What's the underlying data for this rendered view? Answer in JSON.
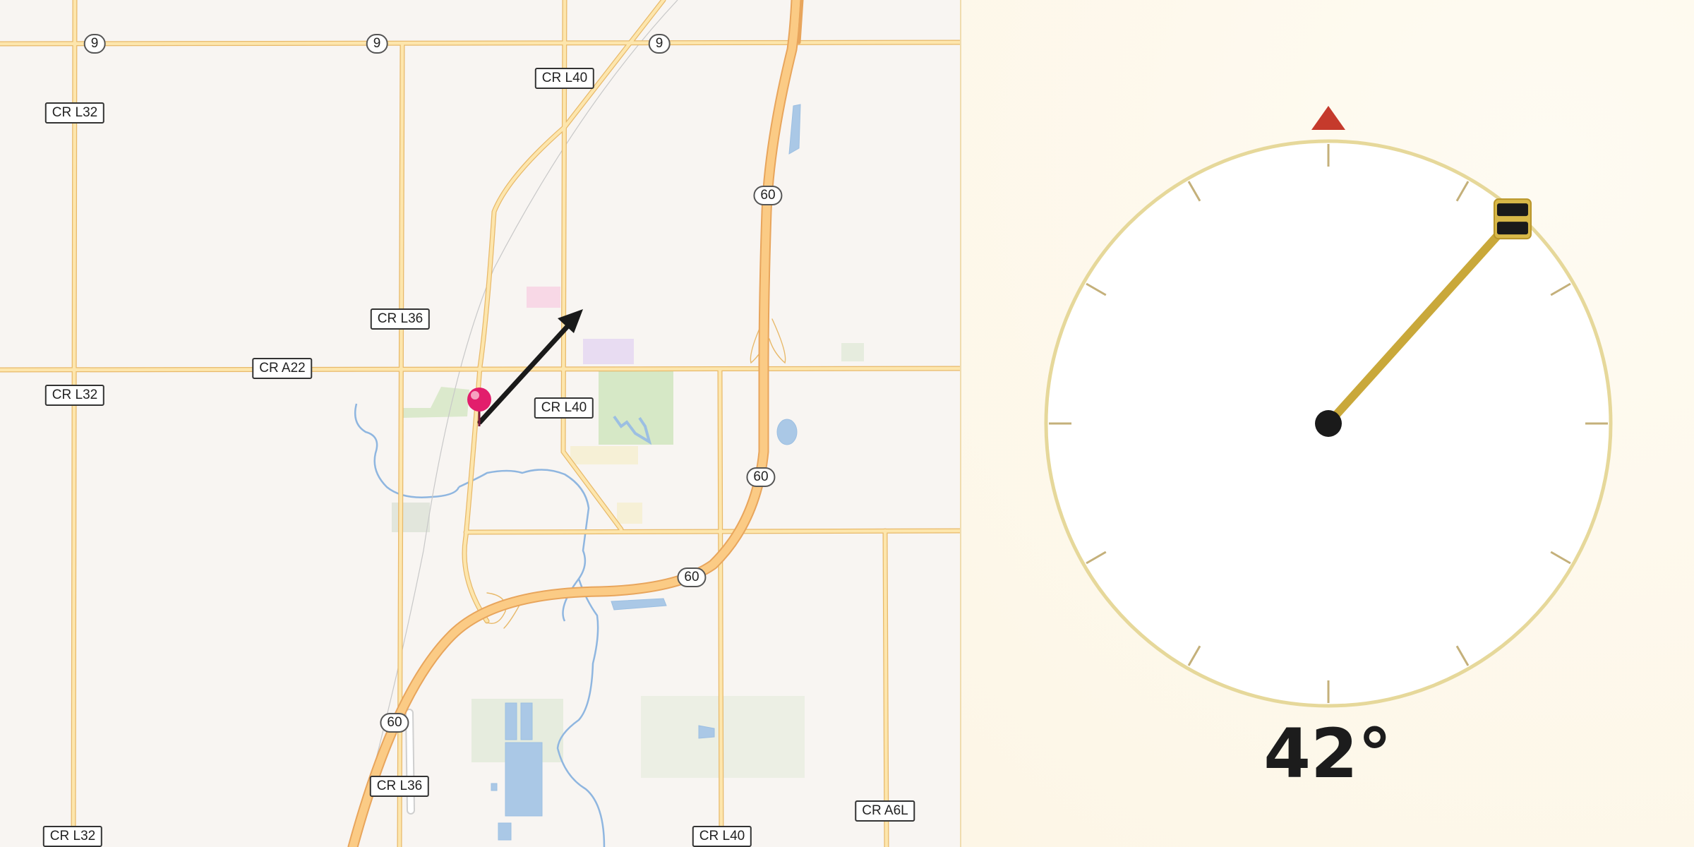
{
  "map": {
    "route_shields": [
      "9",
      "9",
      "9",
      "60",
      "60",
      "60",
      "60"
    ],
    "county_labels": [
      "CR L40",
      "CR L32",
      "CR L36",
      "CR A22",
      "CR L32",
      "CR L40",
      "CR L36",
      "CR L32",
      "CR L40",
      "CR A6L"
    ]
  },
  "compass": {
    "heading_text": "42°",
    "heading_degrees": 42,
    "north_marker_color": "#c53a2c",
    "needle_color": "#c9a83a",
    "ring_color": "#e6d89a"
  },
  "icons": {
    "location_pin": "location-pin-icon",
    "direction_arrow": "direction-arrow-icon",
    "north_marker": "north-marker-icon",
    "needle_handle": "needle-handle-icon"
  }
}
